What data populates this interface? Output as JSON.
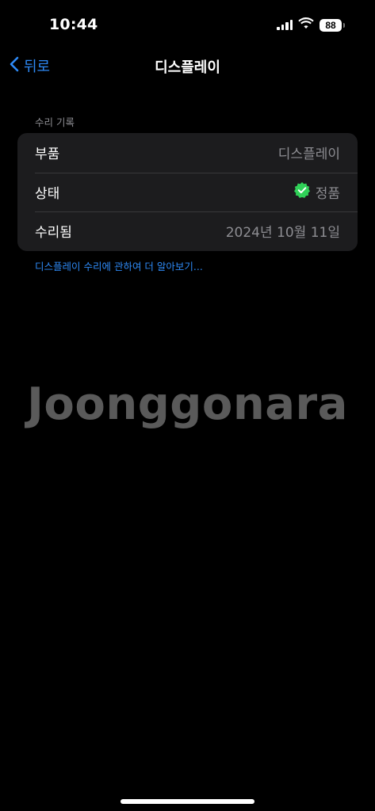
{
  "status_bar": {
    "time": "10:44",
    "battery": "88"
  },
  "nav": {
    "back_label": "뒤로",
    "title": "디스플레이"
  },
  "section": {
    "header": "수리 기록",
    "rows": [
      {
        "label": "부품",
        "value": "디스플레이"
      },
      {
        "label": "상태",
        "value": "정품"
      },
      {
        "label": "수리됨",
        "value": "2024년 10월 11일"
      }
    ],
    "learn_more": "디스플레이 수리에 관하여 더 알아보기..."
  },
  "watermark": "Joonggonara",
  "colors": {
    "accent": "#2e8af6",
    "verified": "#30d158",
    "card_bg": "#1c1c1e",
    "secondary_text": "#8d8d92"
  },
  "icons": {
    "back": "chevron-left-icon",
    "verified": "verified-badge-icon",
    "wifi": "wifi-icon",
    "signal": "cellular-signal-icon"
  }
}
